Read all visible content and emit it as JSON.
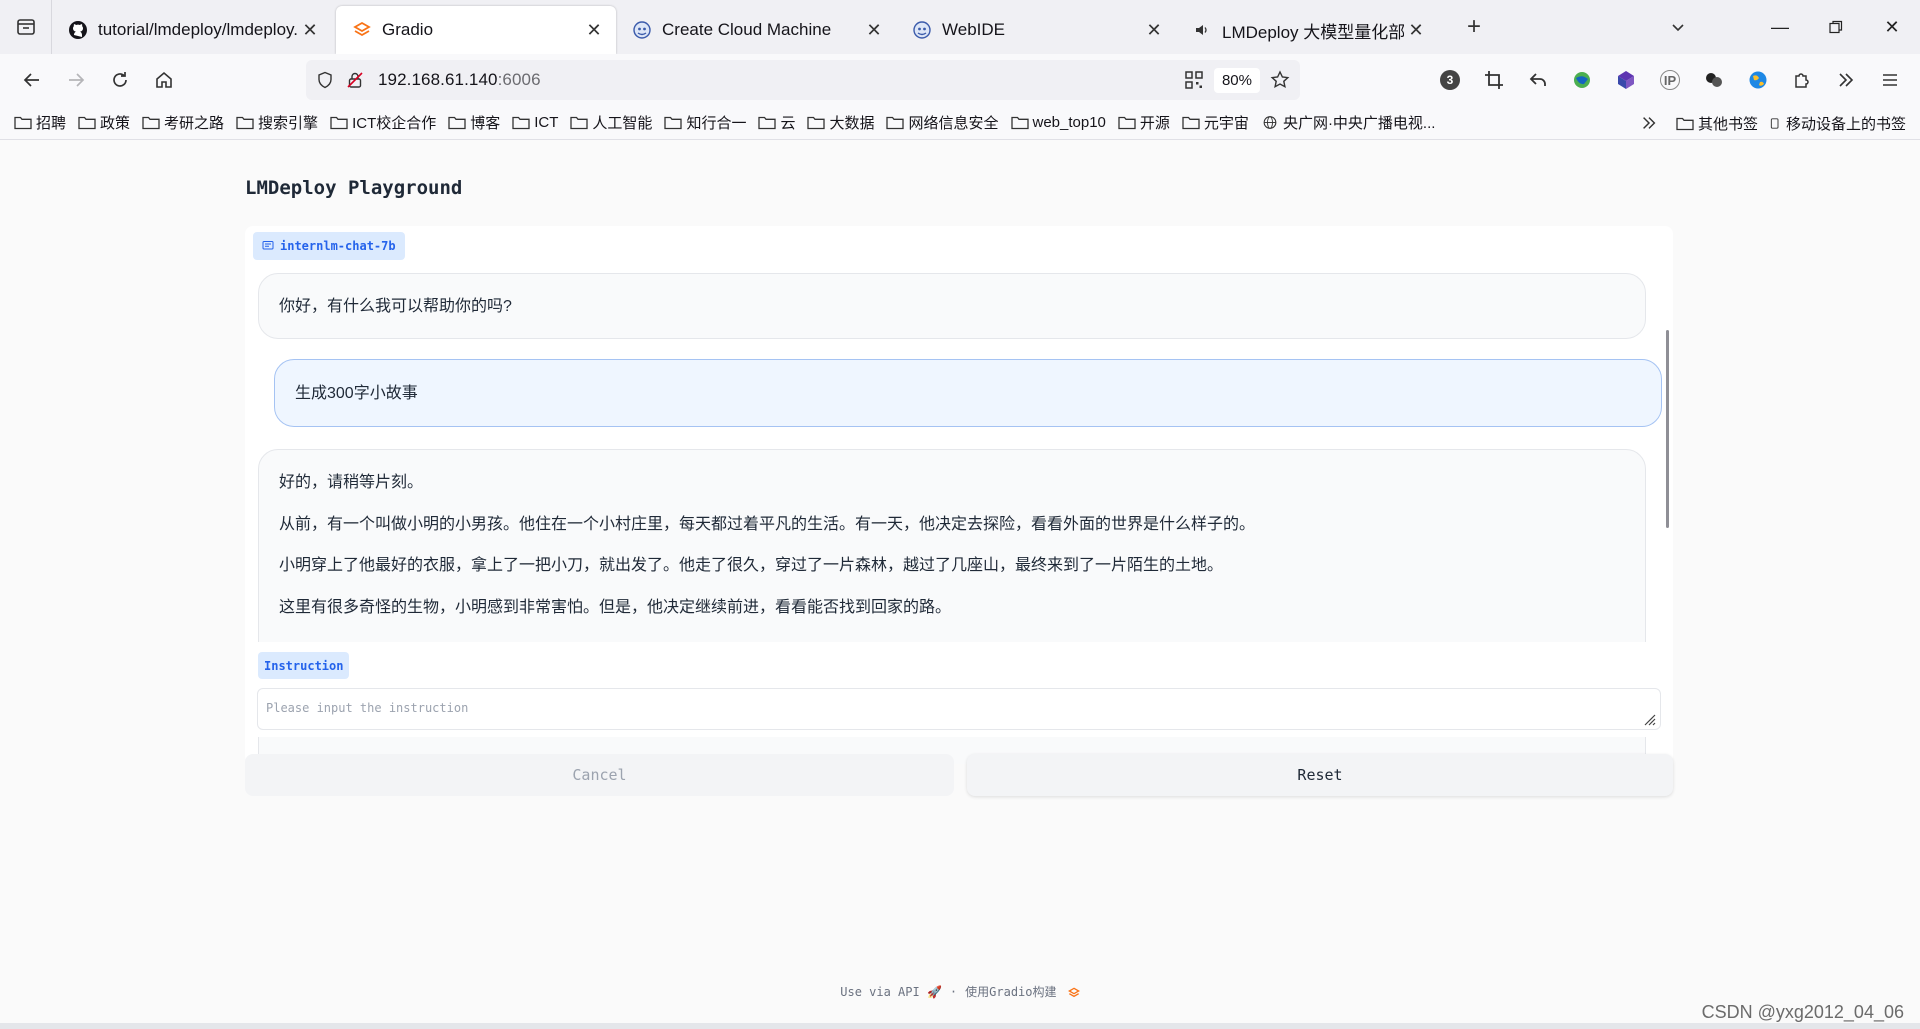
{
  "browser": {
    "tabs": [
      {
        "title": "tutorial/lmdeploy/lmdeploy.md",
        "icon": "github-icon",
        "active": false
      },
      {
        "title": "Gradio",
        "icon": "gradio-icon",
        "active": true
      },
      {
        "title": "Create Cloud Machine",
        "icon": "webide-icon",
        "active": false
      },
      {
        "title": "WebIDE",
        "icon": "webide-icon",
        "active": false
      },
      {
        "title": "LMDeploy 大模型量化部署实践",
        "icon": "speaker-icon",
        "active": false
      }
    ],
    "url_host": "192.168.61.140",
    "url_port": ":6006",
    "zoom": "80%",
    "ext_badge": "3",
    "bookmarks": [
      "招聘",
      "政策",
      "考研之路",
      "搜索引擎",
      "ICT校企合作",
      "博客",
      "ICT",
      "人工智能",
      "知行合一",
      "云",
      "大数据",
      "网络信息安全",
      "web_top10",
      "开源",
      "元宇宙"
    ],
    "bookmark_globe": "央广网·中央广播电视...",
    "bookmark_other": "其他书签",
    "bookmark_mobile": "移动设备上的书签"
  },
  "app": {
    "title": "LMDeploy Playground",
    "chatbot_label": "internlm-chat-7b",
    "messages": {
      "greeting": "你好，有什么我可以帮助你的吗?",
      "user": "生成300字小故事",
      "reply": [
        "好的，请稍等片刻。",
        "从前，有一个叫做小明的小男孩。他住在一个小村庄里，每天都过着平凡的生活。有一天，他决定去探险，看看外面的世界是什么样子的。",
        "小明穿上了他最好的衣服，拿上了一把小刀，就出发了。他走了很久，穿过了一片森林，越过了几座山，最终来到了一片陌生的土地。",
        "这里有很多奇怪的生物，小明感到非常害怕。但是，他决定继续前进，看看能否找到回家的路。"
      ]
    },
    "instruction_label": "Instruction",
    "instruction_placeholder": "Please input the instruction",
    "cancel_label": "Cancel",
    "reset_label": "Reset",
    "footer_api": "Use via API",
    "footer_sep": "·",
    "footer_built": "使用Gradio构建",
    "watermark": "CSDN @yxg2012_04_06",
    "accent_color": "#2563eb",
    "gradio_orange": "#f97316"
  }
}
